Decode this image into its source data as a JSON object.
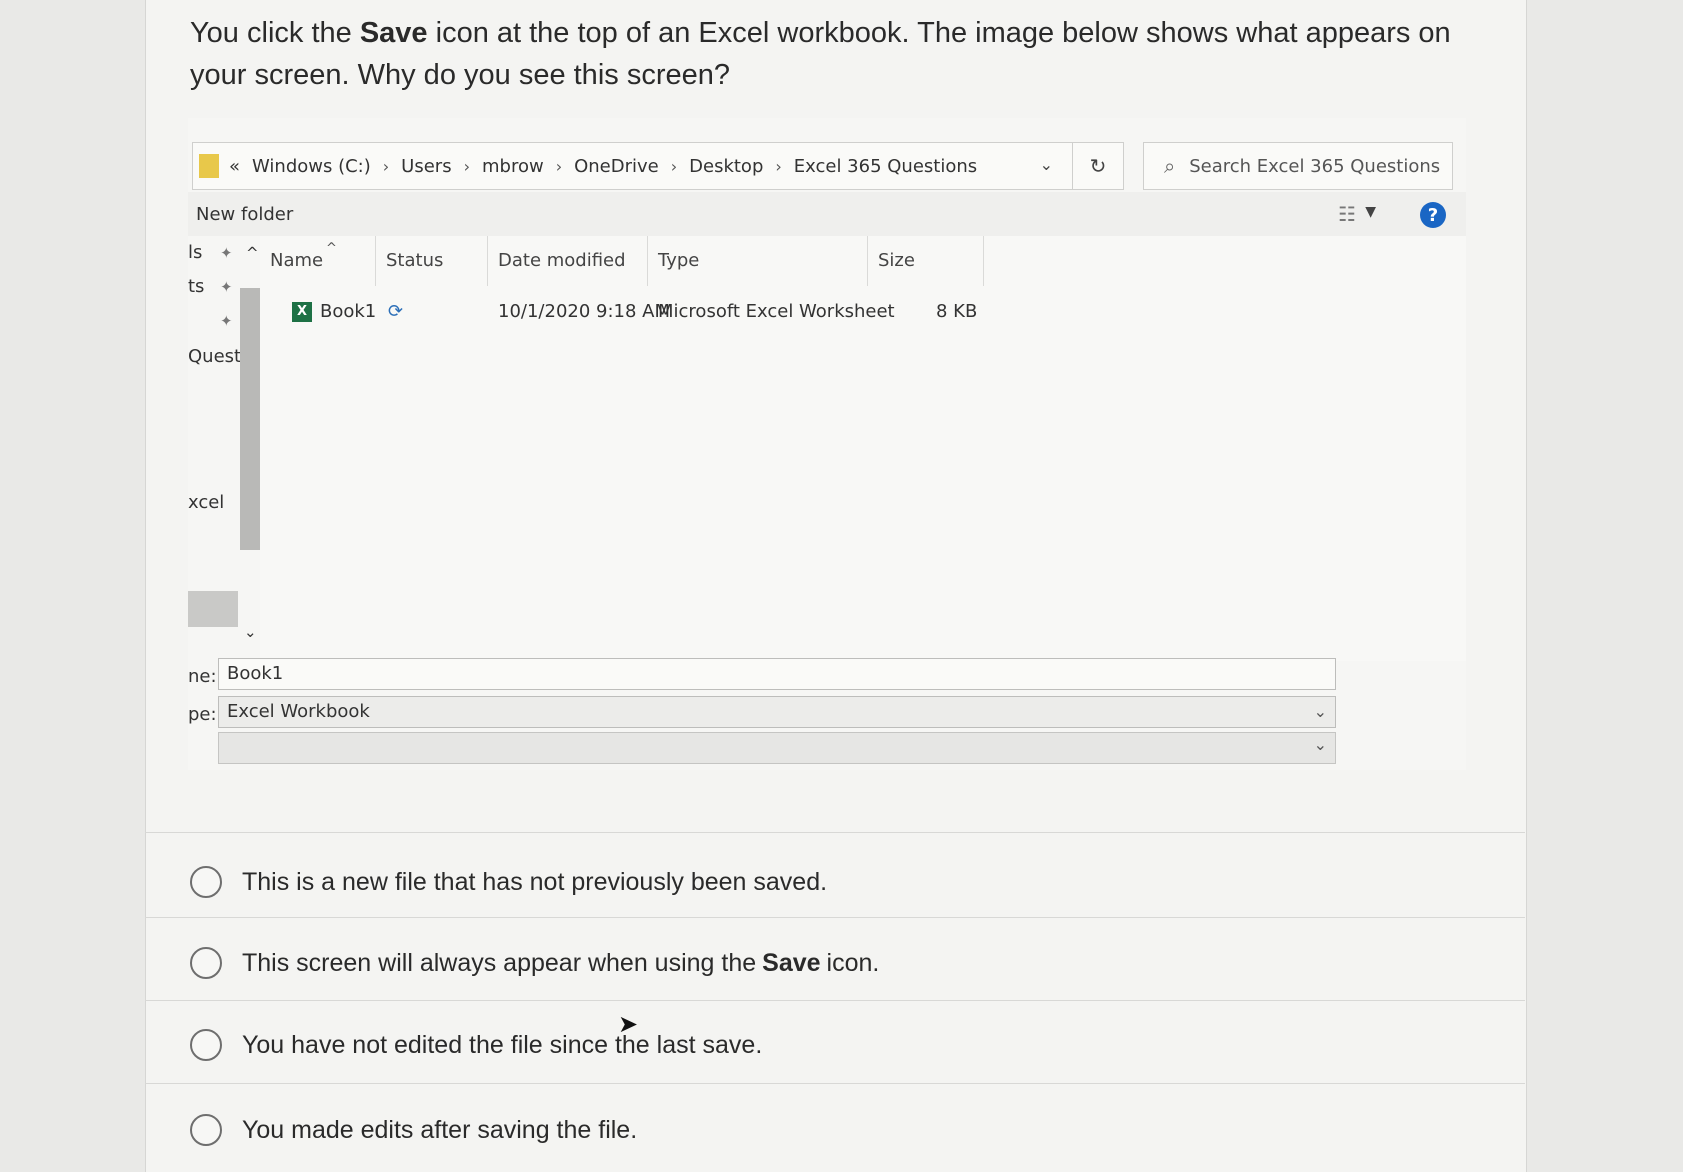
{
  "question": {
    "part1": "You click the",
    "bold": "Save",
    "part2": "icon at the top of an Excel workbook. The image below shows what appears on your screen. Why do you see this screen?"
  },
  "dialog": {
    "breadcrumb": {
      "prefix": "«",
      "items": [
        "Windows (C:)",
        "Users",
        "mbrow",
        "OneDrive",
        "Desktop",
        "Excel 365 Questions"
      ],
      "sep": "›"
    },
    "search_placeholder": "Search Excel 365 Questions",
    "toolbar": {
      "new_folder": "New folder"
    },
    "nav_items": [
      "ls",
      "ts",
      "Questi",
      "xcel"
    ],
    "columns": {
      "name": "Name",
      "status": "Status",
      "date_modified": "Date modified",
      "type": "Type",
      "size": "Size"
    },
    "file": {
      "name": "Book1",
      "date_modified": "10/1/2020 9:18 AM",
      "type": "Microsoft Excel Worksheet",
      "size": "8 KB"
    },
    "file_name_label": "ne:",
    "file_name_value": "Book1",
    "save_type_label": "pe:",
    "save_type_value": "Excel Workbook"
  },
  "options": [
    {
      "text": "This is a new file that has not previously been saved."
    },
    {
      "pre": "This screen will always appear when using the",
      "bold": "Save",
      "post": "icon."
    },
    {
      "text": "You have not edited the file since the last save."
    },
    {
      "text": "You made edits after saving the file."
    }
  ],
  "icons": {
    "folder": "folder-icon",
    "refresh": "refresh-icon",
    "search": "search-icon",
    "help": "help-icon",
    "excel": "excel-file-icon",
    "sync": "sync-icon",
    "pin": "pin-icon"
  },
  "colors": {
    "help_blue": "#1a66c4",
    "excel_green": "#1e7145",
    "folder_yellow": "#e8c84a"
  }
}
